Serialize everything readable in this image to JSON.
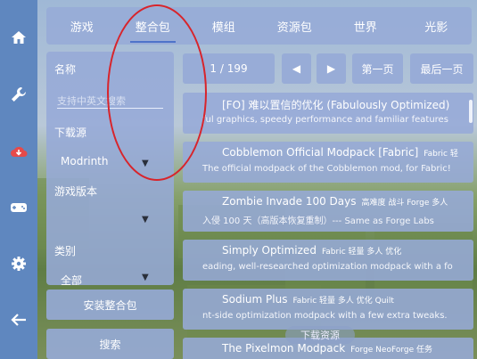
{
  "tabs": [
    "游戏",
    "整合包",
    "模组",
    "资源包",
    "世界",
    "光影"
  ],
  "sidebar_icons": [
    "home-icon",
    "wrench-icon",
    "download-cloud-icon",
    "gamepad-icon",
    "gear-icon",
    "back-arrow-icon"
  ],
  "filter": {
    "name_label": "名称",
    "search_placeholder": "支持中英文搜索",
    "source_label": "下载源",
    "source_value": "Modrinth",
    "version_label": "游戏版本",
    "version_value": "",
    "category_label": "类别",
    "category_value": "全部"
  },
  "buttons": {
    "install": "安装整合包",
    "search": "搜索"
  },
  "pagination": {
    "page": "1 / 199",
    "first": "第一页",
    "last": "最后一页",
    "prev": "◀",
    "next": "▶"
  },
  "items": [
    {
      "title": "[FO] 难以置信的优化 (Fabulously Optimized)",
      "tags": "",
      "desc": "ful graphics, speedy performance and familiar features"
    },
    {
      "title": "Cobblemon Official Modpack [Fabric]",
      "tags": "Fabric  轻",
      "desc": "The official modpack of the Cobblemon mod, for Fabric!"
    },
    {
      "title": "Zombie Invade 100 Days",
      "tags": "高难度  战斗  Forge  多人",
      "desc": "入侵 100 天（高版本恢复重制）--- Same as Forge Labs"
    },
    {
      "title": "Simply Optimized",
      "tags": "Fabric  轻量  多人  优化",
      "desc": "eading, well-researched optimization modpack with a fo"
    },
    {
      "title": "Sodium Plus",
      "tags": "Fabric  轻量  多人  优化  Quilt",
      "desc": "nt-side optimization modpack with a few extra tweaks."
    },
    {
      "title": "The Pixelmon Modpack",
      "tags": "Forge  NeoForge  任务",
      "desc": ""
    }
  ],
  "download_pill": "下载资源",
  "colors": {
    "accent": "#4e73c9",
    "annotation": "#d8242b",
    "rail": "#5f87bf"
  }
}
